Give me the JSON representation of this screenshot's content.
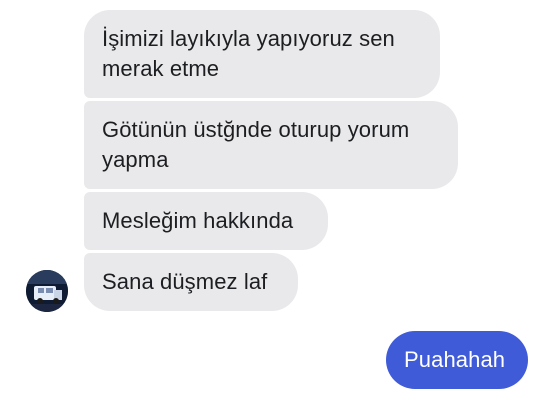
{
  "conversation": {
    "incoming": [
      {
        "lines": [
          "İşimizi layıkıyla yapıyoruz sen",
          "merak etme"
        ]
      },
      {
        "lines": [
          "Götünün üstğnde oturup yorum",
          "yapma"
        ]
      },
      {
        "lines": [
          "Mesleğim hakkında"
        ]
      },
      {
        "lines": [
          "Sana düşmez laf"
        ]
      }
    ],
    "outgoing": [
      {
        "lines": [
          "Puahahah"
        ]
      }
    ]
  },
  "contact": {
    "avatar_icon": "profile-photo"
  },
  "colors": {
    "incoming_bubble": "#e9e9eb",
    "outgoing_bubble": "#3f5bd8",
    "incoming_text": "#1c1e21",
    "outgoing_text": "#ffffff"
  }
}
